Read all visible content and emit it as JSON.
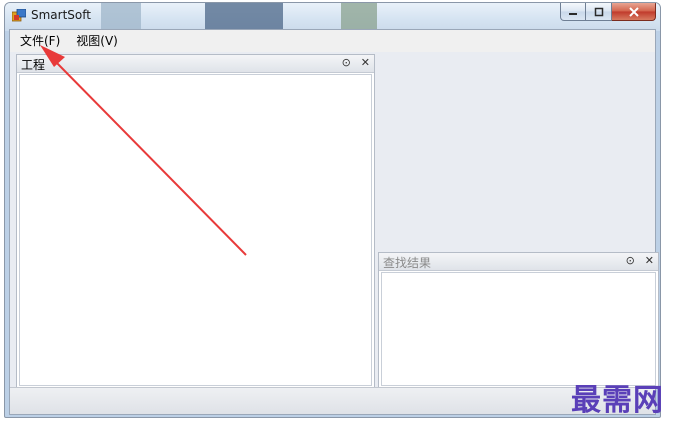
{
  "window": {
    "title": "SmartSoft"
  },
  "menu": {
    "items": [
      {
        "label": "文件(F)"
      },
      {
        "label": "视图(V)"
      }
    ]
  },
  "panels": {
    "project": {
      "title": "工程",
      "pin_label": "⊙",
      "close_label": "✕"
    },
    "search_results": {
      "title": "查找结果",
      "pin_label": "⊙",
      "close_label": "✕"
    }
  },
  "watermark": {
    "text": "最需网"
  },
  "colors": {
    "arrow": "#e83a3a",
    "watermark": "#5a3fb8",
    "close_button": "#c0392b"
  }
}
